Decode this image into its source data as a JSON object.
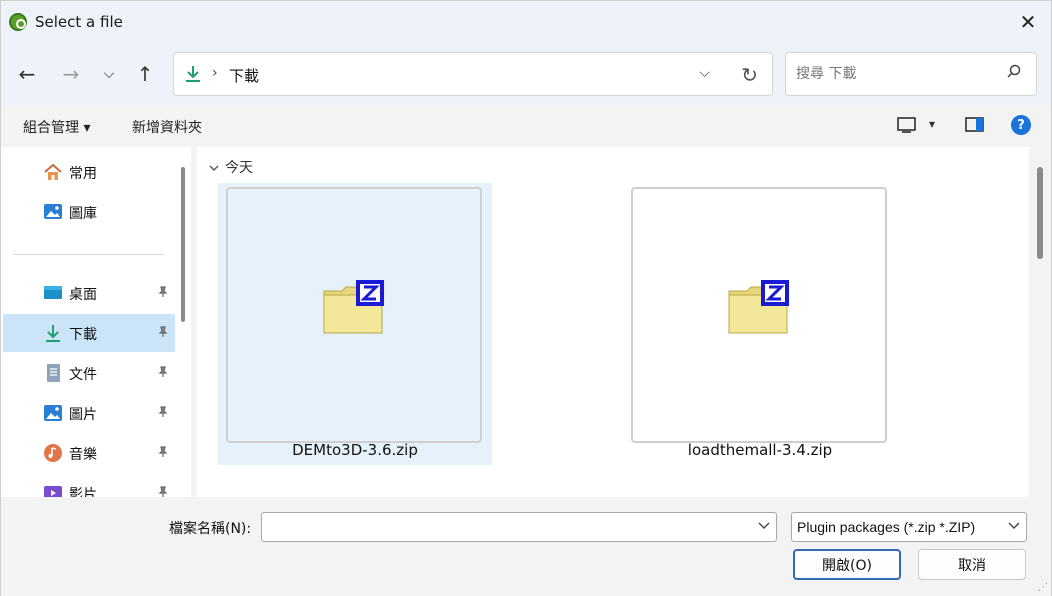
{
  "window": {
    "title": "Select a file",
    "close_glyph": "✕"
  },
  "nav": {
    "back_glyph": "←",
    "forward_glyph": "→",
    "history_glyph": "⌵",
    "up_glyph": "↑",
    "address": {
      "separator": "›",
      "crumb": "下載",
      "dropdown_glyph": "⌵",
      "refresh_glyph": "↻"
    },
    "search": {
      "placeholder": "搜尋 下載",
      "value": ""
    }
  },
  "toolbar": {
    "organize_label": "組合管理 ▾",
    "new_folder_label": "新增資料夾",
    "view_dropdown_glyph": "▾",
    "help_glyph": "?"
  },
  "sidebar": {
    "items": [
      {
        "label": "常用",
        "icon": "home-icon",
        "pinned": false,
        "selected": false
      },
      {
        "label": "圖庫",
        "icon": "gallery-icon",
        "pinned": false,
        "selected": false
      },
      {
        "label": "桌面",
        "icon": "desktop-icon",
        "pinned": true,
        "selected": false
      },
      {
        "label": "下載",
        "icon": "download-icon",
        "pinned": true,
        "selected": true
      },
      {
        "label": "文件",
        "icon": "document-icon",
        "pinned": true,
        "selected": false
      },
      {
        "label": "圖片",
        "icon": "pictures-icon",
        "pinned": true,
        "selected": false
      },
      {
        "label": "音樂",
        "icon": "music-icon",
        "pinned": true,
        "selected": false
      },
      {
        "label": "影片",
        "icon": "video-icon",
        "pinned": true,
        "selected": false
      }
    ],
    "pin_glyph": "📌"
  },
  "content": {
    "group_header": "今天",
    "files": [
      {
        "name": "DEMto3D-3.6.zip",
        "selected": true
      },
      {
        "name": "loadthemall-3.4.zip",
        "selected": false
      }
    ]
  },
  "footer": {
    "filename_label": "檔案名稱(N):",
    "filename_value": "",
    "filter_value": "Plugin packages (*.zip *.ZIP)",
    "open_label": "開啟(O)",
    "cancel_label": "取消"
  },
  "colors": {
    "accent": "#2f6bb3",
    "selection": "#cce4f7",
    "tile_selection": "#e5f1fb",
    "download_green": "#1f9e6e",
    "help_blue": "#1a73d9"
  }
}
